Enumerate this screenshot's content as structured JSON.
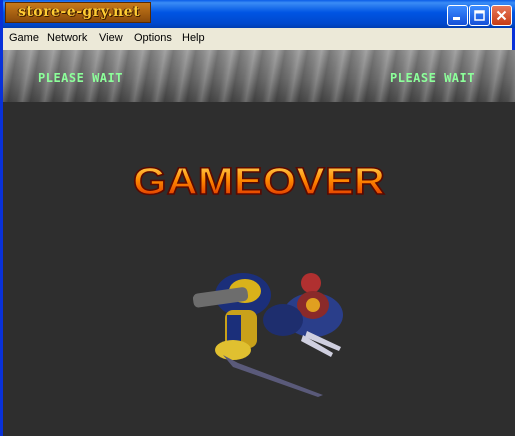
{
  "titlebar": {
    "logo_text": "store-e-gry.net",
    "buttons": [
      "minimize",
      "maximize",
      "close"
    ]
  },
  "menu": {
    "items": [
      "Game",
      "Network",
      "View",
      "Options",
      "Help"
    ]
  },
  "game": {
    "left_status": "PLEASE WAIT",
    "right_status": "PLEASE WAIT",
    "banner": "GAMEOVER"
  },
  "colors": {
    "status_text": "#8cff9a",
    "banner_top": "#ffe066",
    "banner_bottom": "#d61a00",
    "background": "#2e2e2e"
  },
  "icons": {
    "minimize": "minimize-icon",
    "maximize": "maximize-icon",
    "close": "close-icon"
  }
}
